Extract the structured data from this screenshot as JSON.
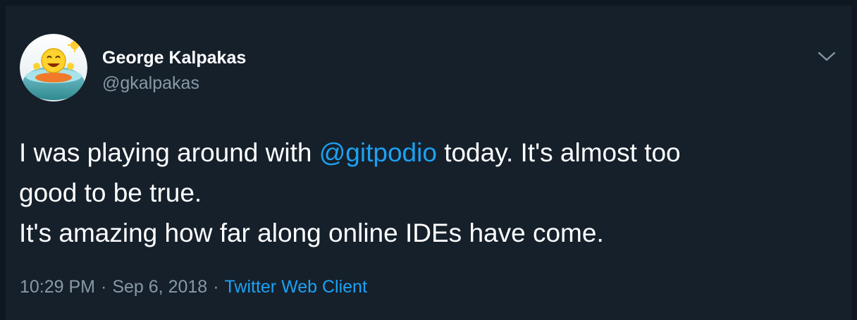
{
  "tweet": {
    "author": {
      "name": "George Kalpakas",
      "handle": "@gkalpakas",
      "avatar_icon": "smiley-in-pool-avatar"
    },
    "menu_icon": "chevron-down-icon",
    "text": {
      "line1_before": "I was playing around with ",
      "mention": "@gitpodio",
      "line1_after": " today. It's almost too",
      "line2": "good to be true.",
      "line3": "It's amazing how far along online IDEs have come."
    },
    "meta": {
      "time": "10:29 PM",
      "separator": "·",
      "date": "Sep 6, 2018",
      "client": "Twitter Web Client"
    }
  },
  "colors": {
    "background": "#15202b",
    "text": "#ffffff",
    "secondary": "#8899a6",
    "accent": "#1da1f2"
  }
}
